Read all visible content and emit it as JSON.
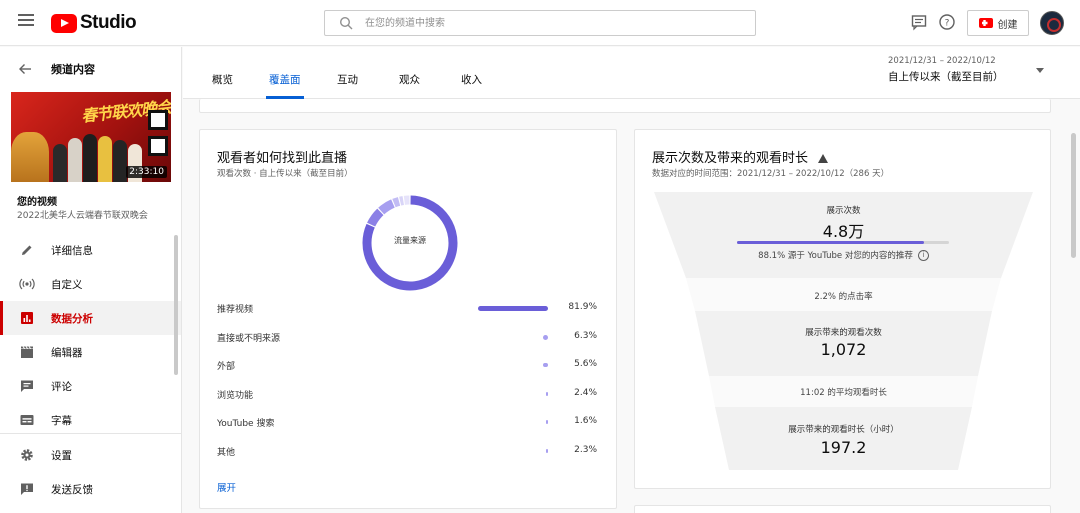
{
  "header": {
    "logo_text": "Studio",
    "search_placeholder": "在您的频道中搜索",
    "create_label": "创建"
  },
  "sidebar": {
    "title": "频道内容",
    "thumbnail": {
      "title_text": "春节联欢晚会",
      "duration": "2:33:10"
    },
    "your_video_label": "您的视频",
    "video_name": "2022北美华人云端春节联双晚会",
    "items": [
      {
        "label": "详细信息",
        "icon": "pencil-icon"
      },
      {
        "label": "自定义",
        "icon": "broadcast-icon"
      },
      {
        "label": "数据分析",
        "icon": "analytics-icon",
        "active": true
      },
      {
        "label": "编辑器",
        "icon": "clapperboard-icon"
      },
      {
        "label": "评论",
        "icon": "comment-icon"
      },
      {
        "label": "字幕",
        "icon": "subtitles-icon"
      },
      {
        "label": "设置",
        "icon": "gear-icon"
      },
      {
        "label": "发送反馈",
        "icon": "feedback-icon"
      }
    ]
  },
  "tabs": [
    {
      "label": "概览"
    },
    {
      "label": "覆盖面",
      "active": true
    },
    {
      "label": "互动"
    },
    {
      "label": "观众"
    },
    {
      "label": "收入"
    }
  ],
  "date_filter": {
    "range": "2021/12/31 – 2022/10/12",
    "label": "自上传以来（截至目前）"
  },
  "traffic_card": {
    "title": "观看者如何找到此直播",
    "subtitle": "观看次数 · 自上传以来（截至目前）",
    "donut_center": "流量来源",
    "expand_label": "展开",
    "sources": [
      {
        "name": "推荐视频",
        "value": "81.9%",
        "pct": 81.9
      },
      {
        "name": "直接或不明来源",
        "value": "6.3%",
        "pct": 6.3
      },
      {
        "name": "外部",
        "value": "5.6%",
        "pct": 5.6
      },
      {
        "name": "浏览功能",
        "value": "2.4%",
        "pct": 2.4
      },
      {
        "name": "YouTube 搜索",
        "value": "1.6%",
        "pct": 1.6
      },
      {
        "name": "其他",
        "value": "2.3%",
        "pct": 2.3
      }
    ]
  },
  "funnel_card": {
    "title": "展示次数及带来的观看时长",
    "subtitle": "数据对应的时间范围：2021/12/31 – 2022/10/12（286 天）",
    "impressions_label": "展示次数",
    "impressions_value": "4.8万",
    "recommend_share_text": "88.1% 源于 YouTube 对您的内容的推荐",
    "recommend_share_pct": 88.1,
    "ctr_text": "2.2% 的点击率",
    "views_label": "展示带来的观看次数",
    "views_value": "1,072",
    "avg_time_text": "11:02 的平均观看时长",
    "watch_time_label": "展示带来的观看时长（小时）",
    "watch_time_value": "197.2"
  },
  "colors": {
    "accent": "#065fd4",
    "brand_red": "#ff0000",
    "active_red": "#cc0000",
    "chart_purple": "#6a5ed8",
    "chart_light": "#a79ff0"
  }
}
